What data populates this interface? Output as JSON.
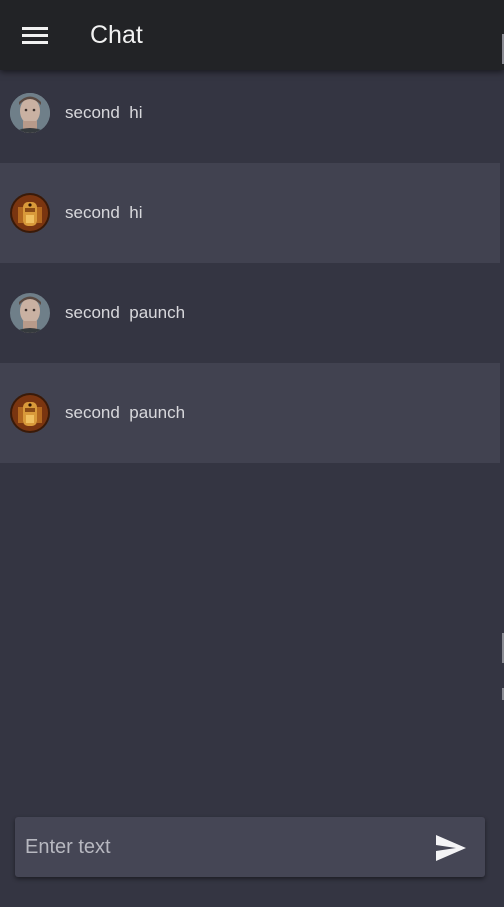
{
  "app_bar": {
    "title": "Chat",
    "menu_icon": "menu-icon"
  },
  "messages": [
    {
      "author": "second",
      "text": "hi",
      "display": "second  hi",
      "avatar": "man-avatar"
    },
    {
      "author": "second",
      "text": "hi",
      "display": "second  hi",
      "avatar": "robot-avatar"
    },
    {
      "author": "second",
      "text": "paunch",
      "display": "second  paunch",
      "avatar": "man-avatar"
    },
    {
      "author": "second",
      "text": "paunch",
      "display": "second  paunch",
      "avatar": "robot-avatar"
    }
  ],
  "composer": {
    "placeholder": "Enter text",
    "value": "",
    "send_icon": "send-icon"
  },
  "colors": {
    "app_bar_bg": "#222326",
    "background": "#343542",
    "alt_row_bg": "#414250",
    "composer_bg": "#454655",
    "text": "#d8d8dc"
  }
}
